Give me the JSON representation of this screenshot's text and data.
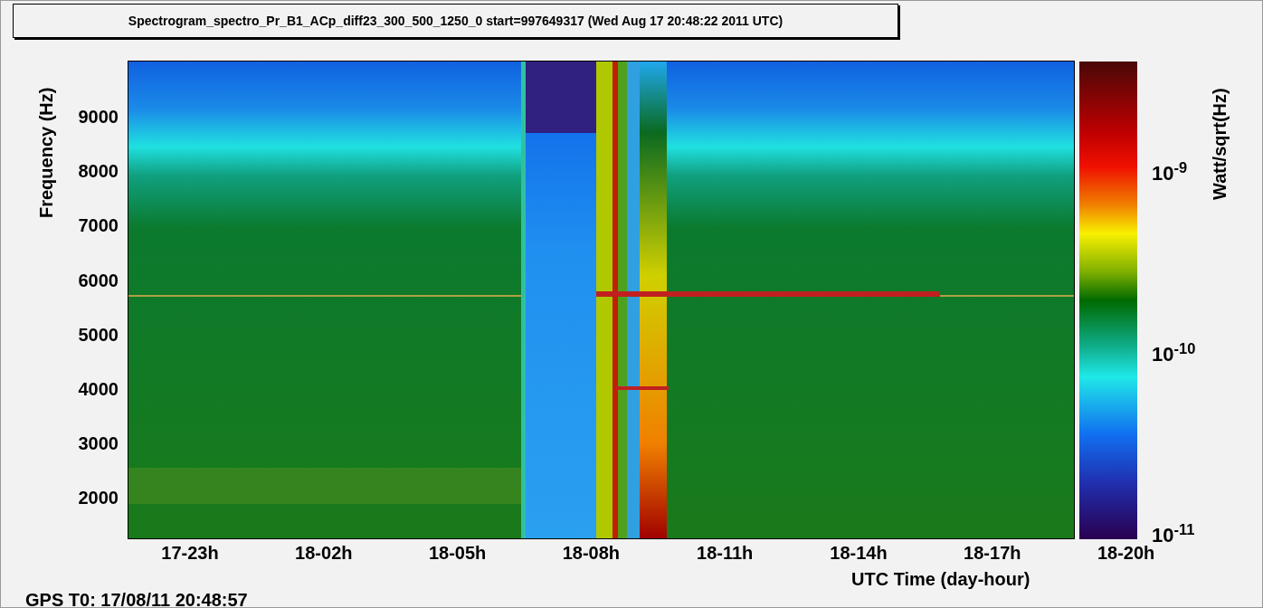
{
  "title": "Spectrogram_spectro_Pr_B1_ACp_diff23_300_500_1250_0 start=997649317 (Wed Aug 17 20:48:22 2011 UTC)",
  "y_axis": {
    "label": "Frequency (Hz)",
    "ticks": [
      "9000",
      "8000",
      "7000",
      "6000",
      "5000",
      "4000",
      "3000",
      "2000"
    ]
  },
  "x_axis": {
    "label": "UTC Time (day-hour)",
    "ticks": [
      "17-23h",
      "18-02h",
      "18-05h",
      "18-08h",
      "18-11h",
      "18-14h",
      "18-17h",
      "18-20h"
    ]
  },
  "colorbar": {
    "label": "Watt/sqrt(Hz)",
    "ticks": [
      "10$^{-9}$",
      "10$^{-10}$",
      "10$^{-11}$"
    ]
  },
  "footer": "GPS T0: 17/08/11 20:48:57"
}
